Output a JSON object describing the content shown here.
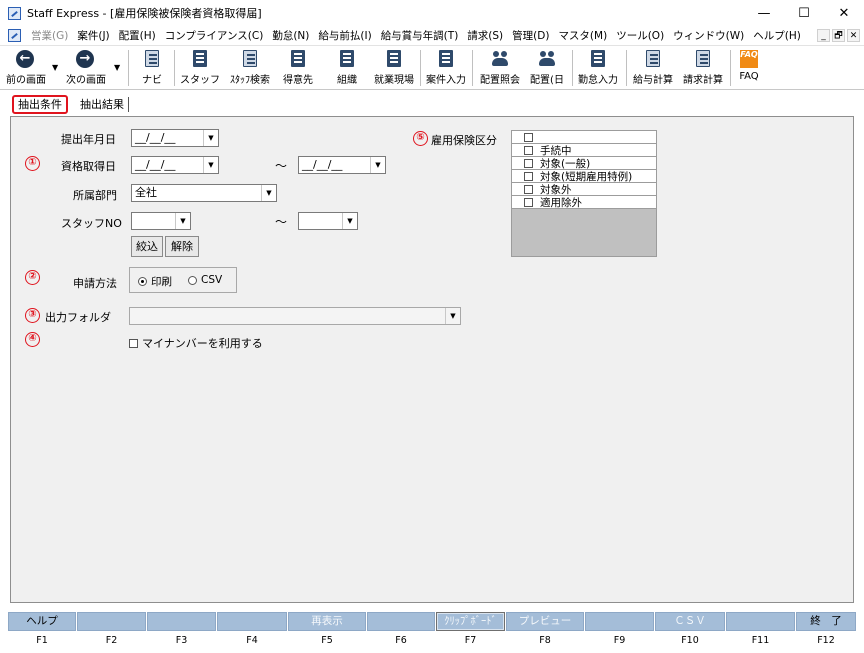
{
  "window": {
    "title": "Staff Express - [雇用保険被保険者資格取得届]",
    "controls": {
      "minimize": "—",
      "maximize": "☐",
      "close": "✕"
    }
  },
  "menu": {
    "items": [
      "営業(G)",
      "案件(J)",
      "配置(H)",
      "コンプライアンス(C)",
      "勤怠(N)",
      "給与前払(I)",
      "給与賞与年調(T)",
      "請求(S)",
      "管理(D)",
      "マスタ(M)",
      "ツール(O)",
      "ウィンドウ(W)",
      "ヘルプ(H)"
    ],
    "mdi": [
      "_",
      "🗗",
      "✕"
    ]
  },
  "toolbar": {
    "prev": "前の画面",
    "next": "次の画面",
    "navi": "ナビ",
    "staff": "スタッフ",
    "staff_search": "ｽﾀｯﾌ検索",
    "client": "得意先",
    "org": "組織",
    "worksite": "就業現場",
    "case_input": "案件入力",
    "placement_query": "配置照会",
    "placement_day": "配置(日",
    "attendance_input": "勤怠入力",
    "payroll_calc": "給与計算",
    "billing_calc": "請求計算",
    "faq": "FAQ",
    "faq_icon_text": "FAQ"
  },
  "tabs": {
    "conditions": "抽出条件",
    "results": "抽出結果"
  },
  "form": {
    "markers": [
      "①",
      "②",
      "③",
      "④",
      "⑤"
    ],
    "submit_date_label": "提出年月日",
    "submit_date_value": "__/__/__",
    "acquire_date_label": "資格取得日",
    "acquire_date_from": "__/__/__",
    "acquire_date_to": "__/__/__",
    "tilde": "～",
    "dept_label": "所属部門",
    "dept_value": "全社",
    "staff_no_label": "スタッフNO",
    "staff_no_from": "",
    "staff_no_to": "",
    "filter_button": "絞込",
    "clear_button": "解除",
    "method_label": "申請方法",
    "method_print": "印刷",
    "method_csv": "CSV",
    "method_selected": "print",
    "folder_label": "出力フォルダ",
    "folder_value": "",
    "mynumber_label": "マイナンバーを利用する",
    "insurance_label": "雇用保険区分",
    "insurance_options": [
      "",
      "手続中",
      "対象(一般)",
      "対象(短期雇用特例)",
      "対象外",
      "適用除外"
    ]
  },
  "fkeys": [
    {
      "key": "F1",
      "label": "ヘルプ",
      "style": "normal"
    },
    {
      "key": "F2",
      "label": "",
      "style": "normal"
    },
    {
      "key": "F3",
      "label": "",
      "style": "normal"
    },
    {
      "key": "F4",
      "label": "",
      "style": "normal"
    },
    {
      "key": "F5",
      "label": "再表示",
      "style": "dim"
    },
    {
      "key": "F6",
      "label": "",
      "style": "normal"
    },
    {
      "key": "F7",
      "label": "ｸﾘｯﾌﾟﾎﾞｰﾄﾞ",
      "style": "outlined"
    },
    {
      "key": "F8",
      "label": "プレビュー",
      "style": "dim"
    },
    {
      "key": "F9",
      "label": "",
      "style": "normal"
    },
    {
      "key": "F10",
      "label": "ＣＳＶ",
      "style": "dim"
    },
    {
      "key": "F11",
      "label": "",
      "style": "normal"
    },
    {
      "key": "F12",
      "label": "終　了",
      "style": "normal"
    }
  ]
}
